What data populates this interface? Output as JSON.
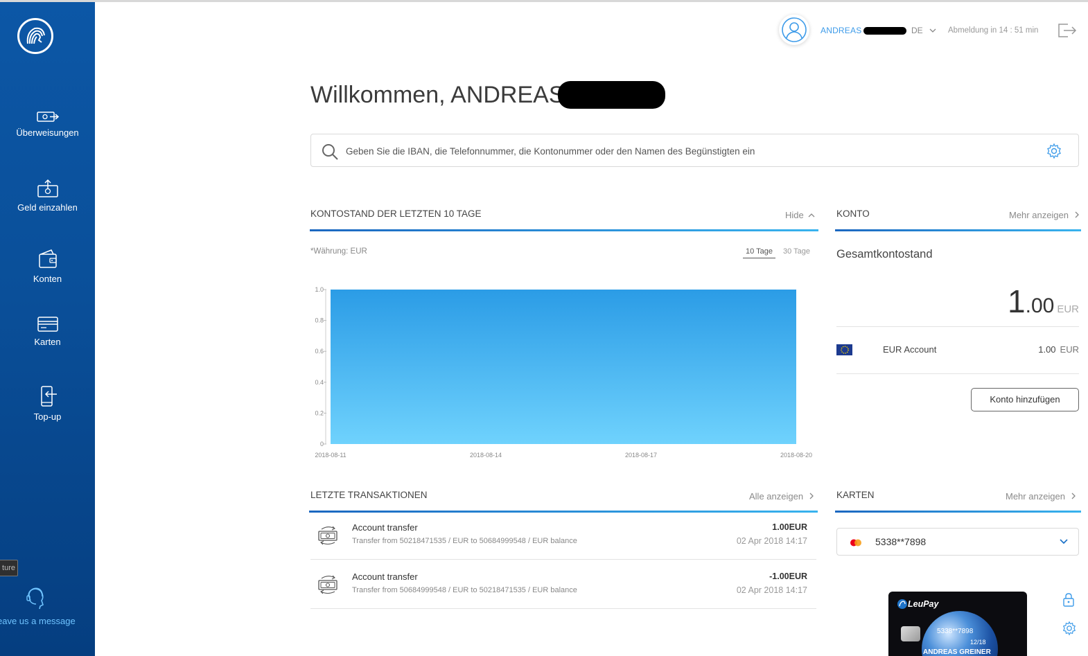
{
  "sidebar": {
    "items": [
      {
        "label": "Überweisungen",
        "icon": "transfer-icon"
      },
      {
        "label": "Geld einzahlen",
        "icon": "deposit-icon"
      },
      {
        "label": "Konten",
        "icon": "wallet-icon"
      },
      {
        "label": "Karten",
        "icon": "card-icon"
      },
      {
        "label": "Top-up",
        "icon": "phone-topup-icon"
      }
    ],
    "tooltip_fragment": "ture",
    "leave_message": "eave us a message"
  },
  "header": {
    "user_name": "ANDREAS",
    "language": "DE",
    "logout_timer": "Abmeldung in 14 : 51 min"
  },
  "welcome": "Willkommen, ANDREAS",
  "search": {
    "placeholder": "Geben Sie die IBAN, die Telefonnummer, die Kontonummer oder den Namen des Begünstigten ein"
  },
  "balance_section": {
    "title": "KONTOSTAND DER LETZTEN 10 TAGE",
    "hide_label": "Hide",
    "currency_note": "*Währung: EUR",
    "tab_10": "10 Tage",
    "tab_30": "30 Tage"
  },
  "chart_data": {
    "type": "area",
    "x": [
      "2018-08-11",
      "2018-08-12",
      "2018-08-13",
      "2018-08-14",
      "2018-08-15",
      "2018-08-16",
      "2018-08-17",
      "2018-08-18",
      "2018-08-19",
      "2018-08-20"
    ],
    "x_ticks": [
      "2018-08-11",
      "2018-08-14",
      "2018-08-17",
      "2018-08-20"
    ],
    "values": [
      1,
      1,
      1,
      1,
      1,
      1,
      1,
      1,
      1,
      1
    ],
    "y_ticks": [
      "0",
      "0.2",
      "0.4",
      "0.6",
      "0.8",
      "1.0"
    ],
    "ylim": [
      0,
      1.0
    ],
    "colors": {
      "top": "#2b9ce6",
      "bottom": "#6fd2fd"
    }
  },
  "konto": {
    "title": "KONTO",
    "more_label": "Mehr anzeigen",
    "total_label": "Gesamtkontostand",
    "total_integer": "1",
    "total_decimal": ".00",
    "total_currency": "EUR",
    "account_name": "EUR Account",
    "account_balance": "1.00",
    "account_currency": "EUR",
    "add_button": "Konto hinzufügen"
  },
  "transactions": {
    "title": "LETZTE TRANSAKTIONEN",
    "all_label": "Alle anzeigen",
    "items": [
      {
        "title": "Account transfer",
        "desc": "Transfer from 50218471535 / EUR to 50684999548 / EUR balance",
        "amount": "1.00EUR",
        "date": "02 Apr 2018 14:17"
      },
      {
        "title": "Account transfer",
        "desc": "Transfer from 50684999548 / EUR to 50218471535 / EUR balance",
        "amount": "-1.00EUR",
        "date": "02 Apr 2018 14:17"
      }
    ]
  },
  "karten": {
    "title": "KARTEN",
    "more_label": "Mehr anzeigen",
    "selected_card": "5338**7898",
    "card_brand": "LeuPay",
    "card_number": "5338**7898",
    "card_expiry": "12/18",
    "card_holder": "ANDREAS GREINER"
  },
  "colors": {
    "accent": "#3d9be9",
    "sidebar": "#0a4f99"
  }
}
